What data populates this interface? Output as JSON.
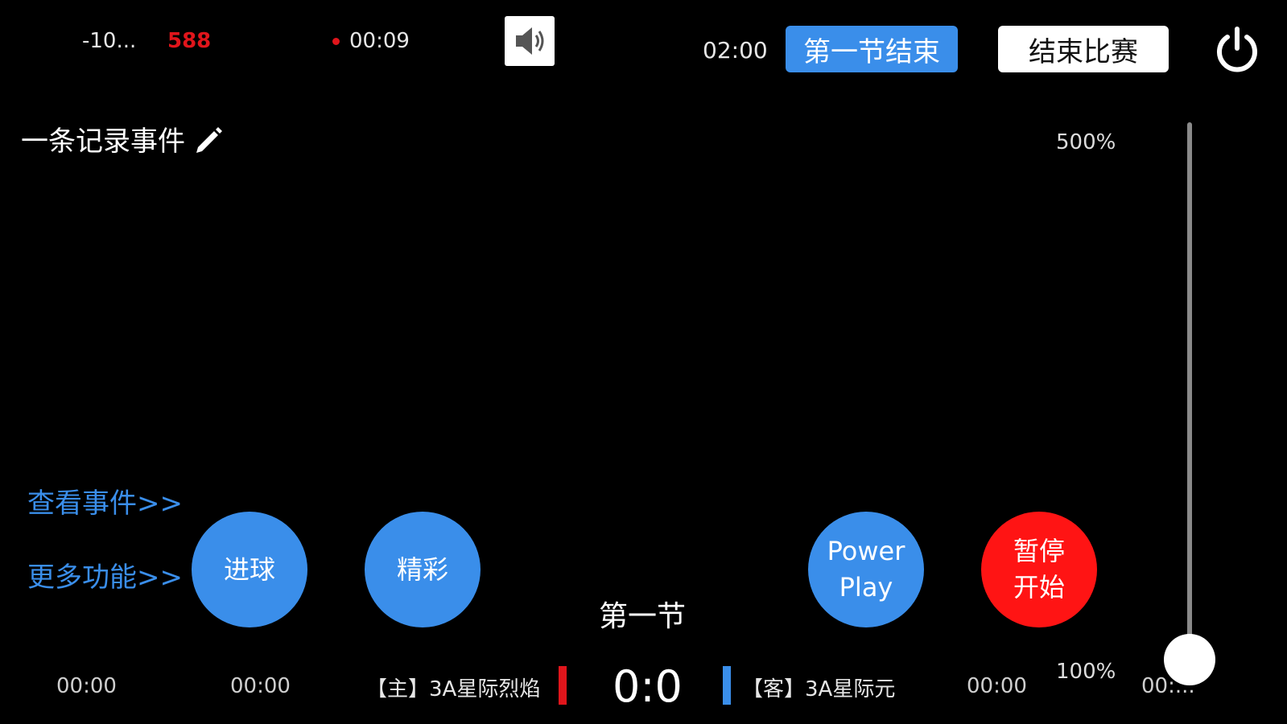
{
  "status": {
    "signal": "-10...",
    "bitrate": "588",
    "rec_time": "00:09",
    "period_clock": "02:00"
  },
  "buttons": {
    "end_period": "第一节结束",
    "end_game": "结束比赛"
  },
  "note": {
    "text": "一条记录事件"
  },
  "zoom": {
    "max_label": "500%",
    "min_label": "100%",
    "level": 0.0
  },
  "links": {
    "view_events": "查看事件>>",
    "more_functions": "更多功能>>"
  },
  "actions": {
    "goal": "进球",
    "highlight": "精彩",
    "powerplay_line1": "Power",
    "powerplay_line2": "Play",
    "pause_line1": "暂停",
    "pause_line2": "开始"
  },
  "scoreboard": {
    "period": "第一节",
    "home_team": "【主】3A星际烈焰",
    "away_team": "【客】3A星际元",
    "score": "0:0",
    "home_color": "#e0151b",
    "away_color": "#3a8eea",
    "timers": [
      "00:00",
      "00:00",
      "00:00",
      "00:..."
    ]
  },
  "colors": {
    "accent": "#3a8eea",
    "danger": "#ff1414",
    "background": "#000000"
  },
  "icons": {
    "speaker": "speaker-icon",
    "power": "power-icon",
    "pencil": "pencil-icon"
  }
}
